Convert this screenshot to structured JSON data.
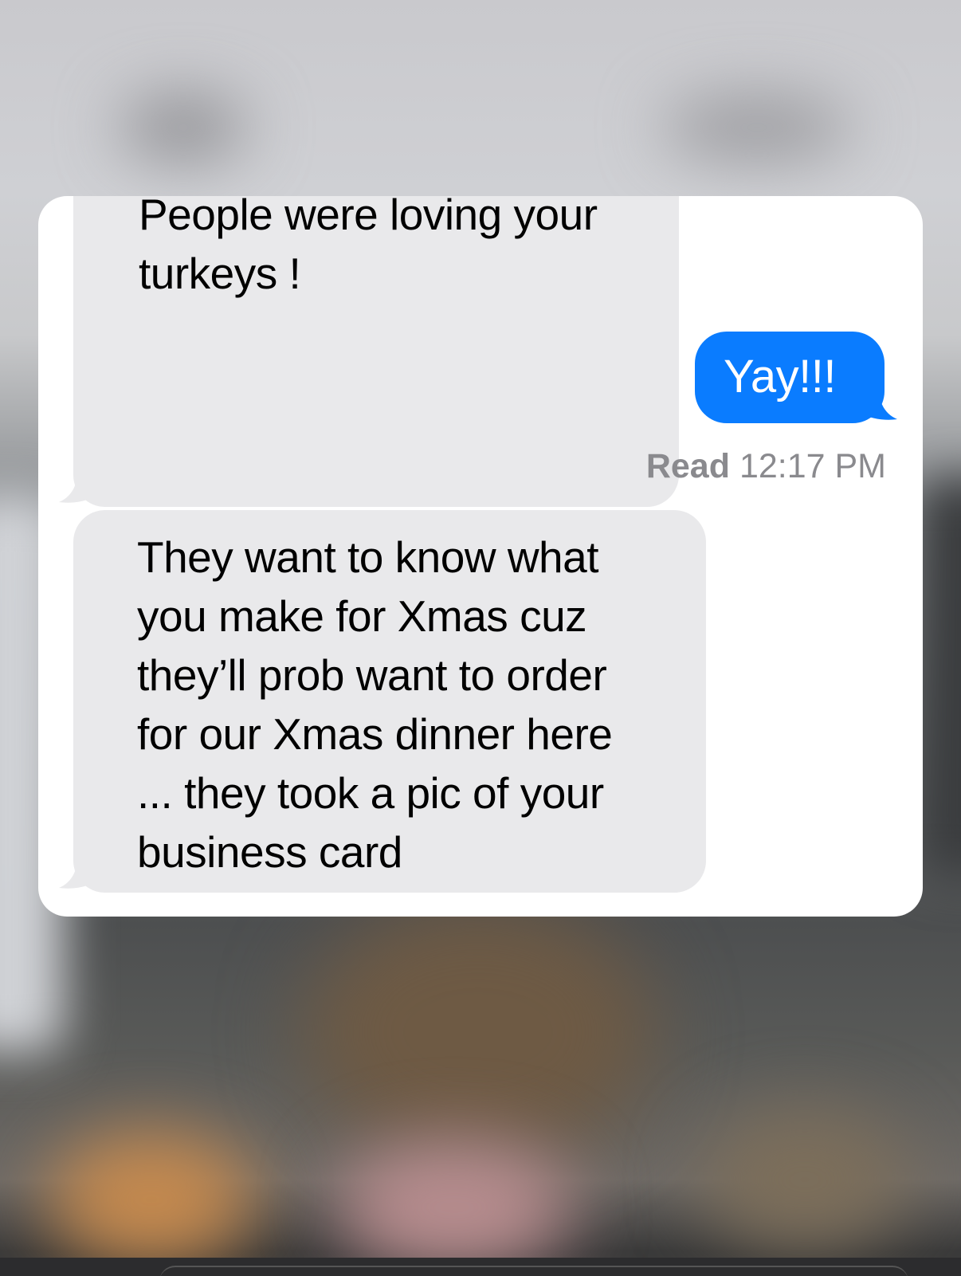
{
  "messages": [
    {
      "direction": "received",
      "text": "People were loving your\nturkeys !"
    },
    {
      "direction": "sent",
      "text": "Yay!!!"
    },
    {
      "direction": "received",
      "text": "They want to know what\nyou make for  Xmas cuz\nthey’ll prob want to order\nfor our Xmas dinner here\n... they took a pic of your\nbusiness card"
    }
  ],
  "read_receipt": {
    "label": "Read",
    "time": "12:17 PM"
  },
  "colors": {
    "sent_bubble": "#0a7cff",
    "received_bubble": "#e9e9eb",
    "card_background": "#ffffff",
    "receipt_text": "#8a8a8e"
  }
}
